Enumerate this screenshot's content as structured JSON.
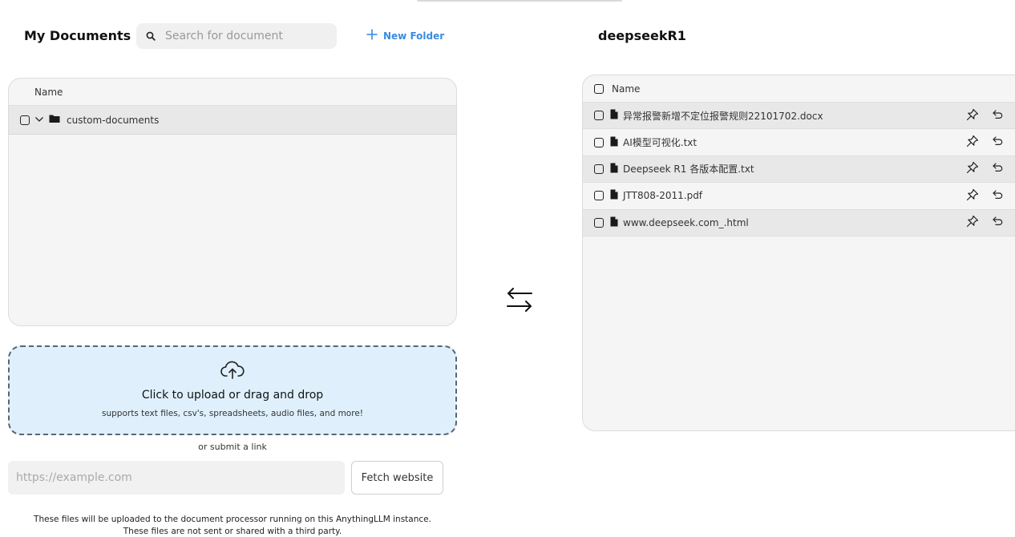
{
  "left": {
    "title": "My Documents",
    "search_placeholder": "Search for document",
    "new_folder_label": "New Folder",
    "column_name": "Name",
    "folders": [
      {
        "name": "custom-documents"
      }
    ]
  },
  "upload": {
    "title": "Click to upload or drag and drop",
    "subtitle": "supports text files, csv's, spreadsheets, audio files, and more!",
    "or_link": "or submit a link",
    "url_placeholder": "https://example.com",
    "fetch_label": "Fetch website",
    "footnote_line1": "These files will be uploaded to the document processor running on this AnythingLLM instance.",
    "footnote_line2": "These files are not sent or shared with a third party."
  },
  "right": {
    "title": "deepseekR1",
    "column_name": "Name",
    "files": [
      {
        "name": "异常报警新增不定位报警规则22101702.docx"
      },
      {
        "name": "AI模型可视化.txt"
      },
      {
        "name": "Deepseek R1 各版本配置.txt"
      },
      {
        "name": "JTT808-2011.pdf"
      },
      {
        "name": "www.deepseek.com_.html"
      }
    ]
  },
  "icons": {
    "search": "search-icon",
    "plus": "plus-icon",
    "folder": "folder-icon",
    "chevron": "chevron-down-icon",
    "cloud_upload": "cloud-upload-icon",
    "swap": "swap-arrows-icon",
    "file": "file-icon",
    "pin": "pin-icon",
    "undo": "undo-icon"
  },
  "colors": {
    "accent": "#3a8be0",
    "upload_bg": "#dff0fc",
    "panel_bg": "#f5f5f5",
    "row_alt": "#e8e8e8"
  }
}
